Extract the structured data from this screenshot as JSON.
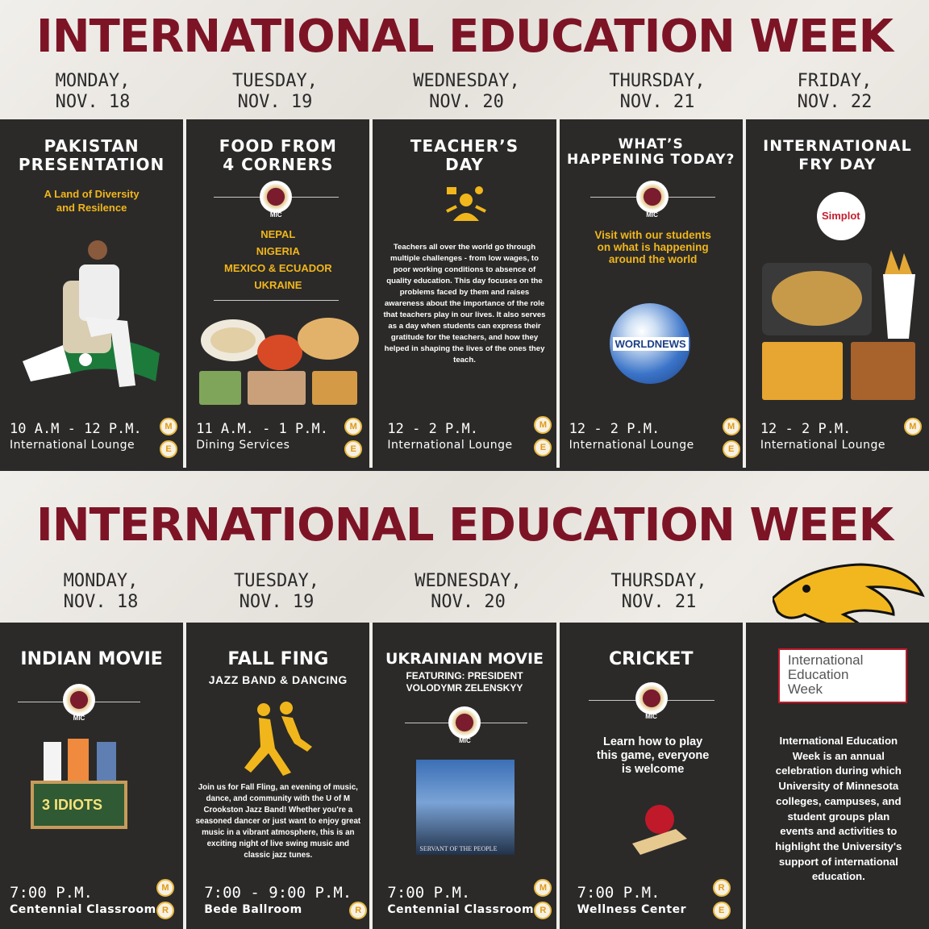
{
  "banner_title": "INTERNATIONAL EDUCATION WEEK",
  "week1": {
    "days": [
      {
        "day": "MONDAY,",
        "date": "NOV. 18"
      },
      {
        "day": "TUESDAY,",
        "date": "NOV. 19"
      },
      {
        "day": "WEDNESDAY,",
        "date": "NOV. 20"
      },
      {
        "day": "THURSDAY,",
        "date": "NOV. 21"
      },
      {
        "day": "FRIDAY,",
        "date": "NOV. 22"
      }
    ],
    "events": [
      {
        "title1": "PAKISTAN",
        "title2": "PRESENTATION",
        "sub1": "A Land of Diversity",
        "sub2": "and Resilence",
        "time": "10 A.M - 12 P.M.",
        "place": "International Lounge",
        "badges": [
          "M",
          "E"
        ]
      },
      {
        "title1": "FOOD FROM",
        "title2": "4 CORNERS",
        "mic": "MIC",
        "list": [
          "NEPAL",
          "NIGERIA",
          "MEXICO & ECUADOR",
          "UKRAINE"
        ],
        "time": "11 A.M. - 1 P.M.",
        "place": "Dining Services",
        "badges": [
          "M",
          "E"
        ]
      },
      {
        "title1": "TEACHER’S",
        "title2": "DAY",
        "desc": "Teachers all over the world go through multiple challenges - from low wages, to poor working conditions to absence of quality education. This day focuses on the problems faced by them and raises awareness about the importance of the role that teachers play in our lives. It also serves as a day when students can express their gratitude for the teachers, and how they helped in shaping the lives of the ones they teach.",
        "time": "12 - 2 P.M.",
        "place": "International Lounge",
        "badges": [
          "M",
          "E"
        ]
      },
      {
        "title1": "WHAT’S",
        "title2": "HAPPENING TODAY?",
        "mic": "MIC",
        "sub": "Visit with our students on what is happening around the world",
        "logo": "WORLDNEWS",
        "time": "12 - 2 P.M.",
        "place": "International Lounge",
        "badges": [
          "M",
          "E"
        ]
      },
      {
        "title1": "INTERNATIONAL",
        "title2": "FRY DAY",
        "logo": "Simplot",
        "time": "12 - 2 P.M.",
        "place": "International Lounge",
        "badges": [
          "M"
        ]
      }
    ]
  },
  "week2": {
    "days": [
      {
        "day": "MONDAY,",
        "date": "NOV. 18"
      },
      {
        "day": "TUESDAY,",
        "date": "NOV. 19"
      },
      {
        "day": "WEDNESDAY,",
        "date": "NOV. 20"
      },
      {
        "day": "THURSDAY,",
        "date": "NOV. 21"
      }
    ],
    "events": [
      {
        "title1": "INDIAN MOVIE",
        "mic": "MIC",
        "poster": "3 IDIOTS",
        "time": "7:00 P.M.",
        "place": "Centennial Classroom",
        "badges": [
          "M",
          "R"
        ]
      },
      {
        "title1": "FALL FING",
        "title2": "JAZZ BAND & DANCING",
        "desc": "Join us for Fall Fling, an evening of music, dance, and community with the U of M Crookston Jazz Band! Whether you're a seasoned dancer or just want to enjoy great music in a vibrant atmosphere, this is an exciting night of live swing music and classic jazz tunes.",
        "time": "7:00 - 9:00 P.M.",
        "place": "Bede Ballroom",
        "badges": [
          "R"
        ]
      },
      {
        "title1": "UKRAINIAN MOVIE",
        "title2": "FEATURING: PRESIDENT",
        "title3": "VOLODYMR ZELENSKYY",
        "mic": "MIC",
        "poster": "SERVANT OF THE PEOPLE",
        "time": "7:00 P.M.",
        "place": "Centennial Classroom",
        "badges": [
          "M",
          "R"
        ]
      },
      {
        "title1": "CRICKET",
        "mic": "MIC",
        "sub": "Learn how to play this game, everyone is welcome",
        "time": "7:00 P.M.",
        "place": "Wellness Center",
        "badges": [
          "R",
          "E"
        ]
      },
      {
        "logo1": "International",
        "logo2": "Education",
        "logo3": "Week",
        "desc": "International Education Week is an annual celebration during which University of Minnesota colleges, campuses, and student groups plan events and activities to highlight the University's support of international education."
      }
    ]
  }
}
